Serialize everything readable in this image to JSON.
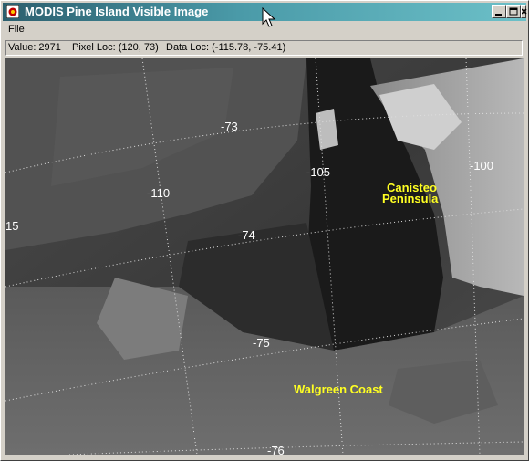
{
  "window": {
    "title": "MODIS Pine Island Visible Image",
    "controls": [
      "minimize",
      "maximize",
      "close"
    ]
  },
  "menu": {
    "items": [
      "File"
    ]
  },
  "status": {
    "value": "Value: 2971",
    "pixel_loc": "Pixel Loc: (120, 73)",
    "data_loc": "Data Loc: (-115.78, -75.41)"
  },
  "image": {
    "latitude_labels": [
      "-73",
      "-74",
      "-75",
      "-76"
    ],
    "longitude_labels": [
      "15",
      "-110",
      "-105",
      "-100"
    ],
    "place_names": {
      "canisteo_line1": "Canisteo",
      "canisteo_line2": "Peninsula",
      "walgreen": "Walgreen Coast"
    }
  },
  "colors": {
    "title_gradient_start": "#2c5f6e",
    "title_gradient_end": "#6cc0c8",
    "place_label": "#ffff22",
    "graticule": "#dddddd"
  }
}
